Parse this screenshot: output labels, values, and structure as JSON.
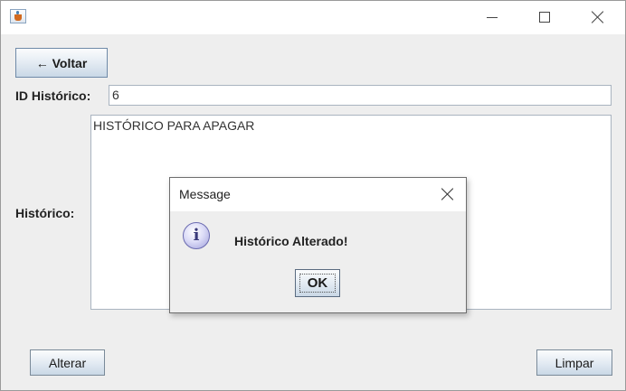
{
  "window": {
    "app_icon": "java-cup-icon",
    "controls": {
      "minimize": "minimize-icon",
      "maximize": "maximize-icon",
      "close": "close-icon"
    }
  },
  "form": {
    "back_button_label": "← Voltar",
    "id_label": "ID Histórico:",
    "id_value": "6",
    "historico_label": "Histórico:",
    "historico_value": "HISTÓRICO PARA APAGAR",
    "alterar_label": "Alterar",
    "limpar_label": "Limpar"
  },
  "dialog": {
    "title": "Message",
    "icon": "info-icon",
    "icon_glyph": "i",
    "message": "Histórico Alterado!",
    "ok_label": "OK"
  }
}
